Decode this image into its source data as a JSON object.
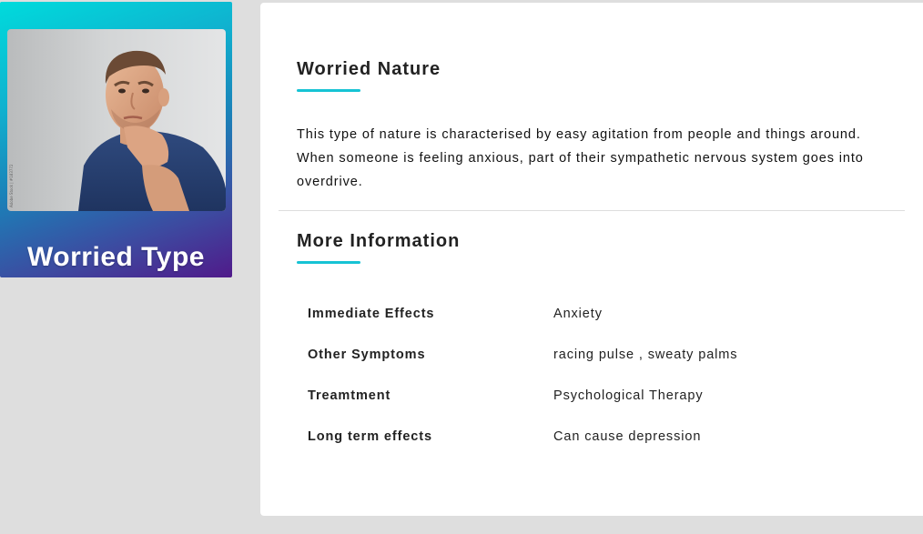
{
  "profile_card": {
    "title": "Worried Type",
    "photo_alt": "Man with hand on chin looking worried",
    "gradient_colors": [
      "#00dbdc",
      "#501a8a"
    ]
  },
  "nature_section": {
    "heading": "Worried Nature",
    "description": "This type of nature is characterised by easy agitation from people and things around. When someone is feeling anxious, part of their sympathetic nervous system goes into overdrive."
  },
  "more_info_section": {
    "heading": "More Information",
    "rows": [
      {
        "label": "Immediate Effects",
        "value": "Anxiety"
      },
      {
        "label": "Other Symptoms",
        "value": "racing pulse , sweaty palms"
      },
      {
        "label": "Treamtment",
        "value": "Psychological Therapy"
      },
      {
        "label": "Long term effects",
        "value": "Can cause depression"
      }
    ]
  },
  "colors": {
    "accent": "#16c3d4",
    "page_background": "#dedede",
    "panel_background": "#ffffff"
  }
}
